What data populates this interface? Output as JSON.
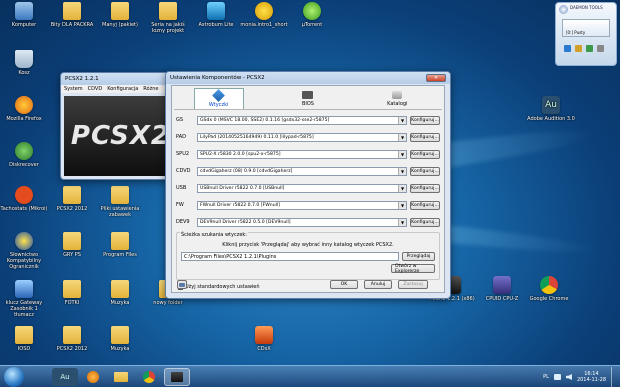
{
  "desktop_icons": [
    {
      "id": "komputer",
      "label": "Komputer"
    },
    {
      "id": "kosz",
      "label": "Kosz"
    },
    {
      "id": "firefox",
      "label": "Mozilla Firefox"
    },
    {
      "id": "diskrecovery",
      "label": "Diskrecover"
    },
    {
      "id": "tachostat",
      "label": "Tachostats (Mikroi)"
    },
    {
      "id": "slowo",
      "label": "Słownictwo Kompatybilny Ogranicznik"
    },
    {
      "id": "keytu",
      "label": "klucz Gateway Zasobnik 1 tłumacz"
    },
    {
      "id": "iosd",
      "label": "IOSD"
    },
    {
      "id": "bity",
      "label": "Bity DLA PACKRA"
    },
    {
      "id": "manyj",
      "label": "Manyj (pakiet)"
    },
    {
      "id": "seria",
      "label": "Seria na jakiś lozny projekt"
    },
    {
      "id": "astrobum",
      "label": "Astrobum Lite"
    },
    {
      "id": "monia",
      "label": "monia.intro1_short"
    },
    {
      "id": "utorrent",
      "label": "µTorrent"
    },
    {
      "id": "audition",
      "label": "Adobe Audition 3.0"
    },
    {
      "id": "pcsx2dsk",
      "label": "PCSX2 1.2.1 (x86)"
    },
    {
      "id": "cpuid",
      "label": "CPUID CPU-Z"
    },
    {
      "id": "chrome",
      "label": "Google Chrome"
    },
    {
      "id": "pcsx2folder",
      "label": "PCSX2 2012"
    },
    {
      "id": "pliki",
      "label": "Pliki ustawienia zabawek"
    },
    {
      "id": "gry",
      "label": "GRY PS"
    },
    {
      "id": "program",
      "label": "Program Files"
    },
    {
      "id": "fotki",
      "label": "FOTKI"
    },
    {
      "id": "muzyka",
      "label": "Muzyka"
    },
    {
      "id": "nowy",
      "label": "nowy folder"
    },
    {
      "id": "pcsx2folder2",
      "label": "PCSX2 2012"
    },
    {
      "id": "muzyka2",
      "label": "Muzyka"
    },
    {
      "id": "cdsx",
      "label": "CDsX"
    }
  ],
  "pcsx2_main": {
    "title": "PCSX2  1.2.1",
    "menu": [
      "System",
      "CDVD",
      "Konfiguracja",
      "Różne"
    ],
    "logo": "PCSX2"
  },
  "settings_window": {
    "title": "Ustawienia Komponentów - PCSX2",
    "tabs": [
      {
        "id": "wtyczki",
        "label": "Wtyczki",
        "active": true
      },
      {
        "id": "bios",
        "label": "BIOS",
        "active": false
      },
      {
        "id": "katalogi",
        "label": "Katalogi",
        "active": false
      }
    ],
    "plugins": [
      {
        "id": "gs",
        "label": "GS",
        "value": "GSdx 0 (MSVC 18.00, SSE2) 0.1.16 [gsdx32-sse2-r5875]",
        "button": "Konfiguruj..."
      },
      {
        "id": "pad",
        "label": "PAD",
        "value": "LilyPad (20140525164949) 0.11.0 [lilypad-r5875]",
        "button": "Konfiguruj..."
      },
      {
        "id": "spu2",
        "label": "SPU2",
        "value": "SPU2-X r5830 2.0.0 [spu2-x-r5875]",
        "button": "Konfiguruj..."
      },
      {
        "id": "cdvd",
        "label": "CDVD",
        "value": "cdvdGigaherz (08) 0.9.0 [cdvdGigaherz]",
        "button": "Konfiguruj..."
      },
      {
        "id": "usb",
        "label": "USB",
        "value": "USBnull Driver r5822 0.7.0 [USBnull]",
        "button": "Konfiguruj..."
      },
      {
        "id": "fw",
        "label": "FW",
        "value": "FWnull Driver r5822 0.7.0 [FWnull]",
        "button": "Konfiguruj..."
      },
      {
        "id": "dev9",
        "label": "DEV9",
        "value": "DEV9null Driver r5822 0.5.0 [DEV9null]",
        "button": "Konfiguruj..."
      }
    ],
    "search_group_label": "Ścieżka szukania wtyczek:",
    "search_hint": "Kliknij przycisk 'Przeglądaj' aby wybrać inny katalog wtyczek PCSX2.",
    "path_value": "C:\\Program Files\\PCSX2 1.2.1\\Plugins",
    "browse_label": "Przeglądaj",
    "explorer_label": "Otwórz w Explorerze",
    "use_default_label": "Użyj standardowych ustawień",
    "ok_label": "OK",
    "cancel_label": "Anuluj",
    "apply_label": "Zastosuj"
  },
  "daemon": {
    "title": "DAEMON TOOLS",
    "drive": "[0:] Pusty"
  },
  "taskbar": {
    "time": "16:14",
    "date": "2014-11-28",
    "lang": "PL"
  },
  "colors": {
    "desktop": "#1767a8",
    "taskbar": "#3a6ea5",
    "accent": "#3b7fd4"
  }
}
